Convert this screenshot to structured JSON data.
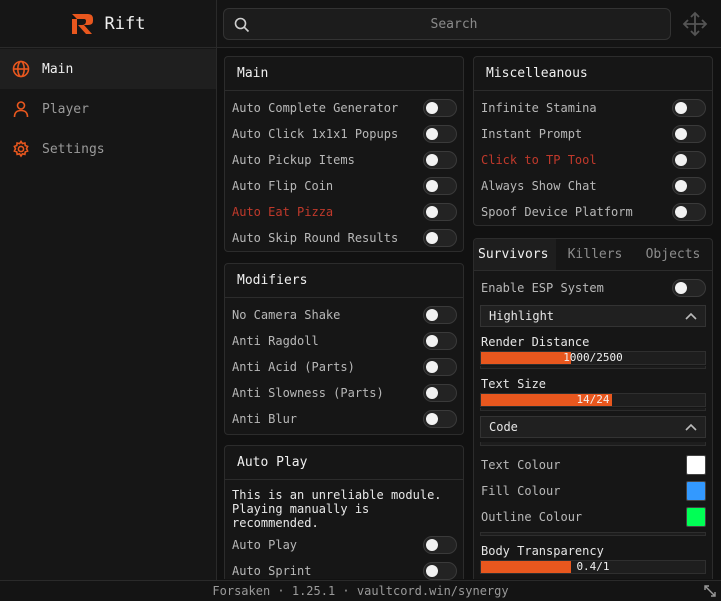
{
  "app": {
    "title": "Rift"
  },
  "sidebar": {
    "items": [
      {
        "label": "Main",
        "icon": "globe-icon"
      },
      {
        "label": "Player",
        "icon": "user-icon"
      },
      {
        "label": "Settings",
        "icon": "gear-icon"
      }
    ]
  },
  "search": {
    "placeholder": "Search"
  },
  "colors": {
    "accent": "#e8571e",
    "danger": "#c0392b"
  },
  "main_panel": {
    "title": "Main",
    "rows": [
      {
        "label": "Auto Complete Generator"
      },
      {
        "label": "Auto Click 1x1x1 Popups"
      },
      {
        "label": "Auto Pickup Items"
      },
      {
        "label": "Auto Flip Coin"
      },
      {
        "label": "Auto Eat Pizza"
      },
      {
        "label": "Auto Skip Round Results"
      }
    ]
  },
  "modifiers_panel": {
    "title": "Modifiers",
    "rows": [
      {
        "label": "No Camera Shake"
      },
      {
        "label": "Anti Ragdoll"
      },
      {
        "label": "Anti Acid (Parts)"
      },
      {
        "label": "Anti Slowness (Parts)"
      },
      {
        "label": "Anti Blur"
      }
    ]
  },
  "autoplay_panel": {
    "title": "Auto Play",
    "note_line1": "This is an unreliable module.",
    "note_line2": "Playing manually is recommended.",
    "rows": [
      {
        "label": "Auto Play"
      },
      {
        "label": "Auto Sprint"
      }
    ]
  },
  "misc_panel": {
    "title": "Miscelleanous",
    "rows": [
      {
        "label": "Infinite Stamina"
      },
      {
        "label": "Instant Prompt"
      },
      {
        "label": "Click to TP Tool"
      },
      {
        "label": "Always Show Chat"
      },
      {
        "label": "Spoof Device Platform"
      }
    ]
  },
  "esp_panel": {
    "tabs": [
      "Survivors",
      "Killers",
      "Objects"
    ],
    "enable_label": "Enable ESP System",
    "highlight_dropdown": "Highlight",
    "render_distance": {
      "label": "Render Distance",
      "text": "1000/2500",
      "fraction": 0.4
    },
    "text_size": {
      "label": "Text Size",
      "text": "14/24",
      "fraction": 0.5833
    },
    "code_dropdown": "Code",
    "text_colour": {
      "label": "Text Colour",
      "color": "#ffffff"
    },
    "fill_colour": {
      "label": "Fill Colour",
      "color": "#3399ff"
    },
    "outline_colour": {
      "label": "Outline Colour",
      "color": "#00ff55"
    },
    "body_transparency": {
      "label": "Body Transparency",
      "text": "0.4/1",
      "fraction": 0.4
    }
  },
  "footer": {
    "text": "Forsaken · 1.25.1 · vaultcord.win/synergy"
  }
}
